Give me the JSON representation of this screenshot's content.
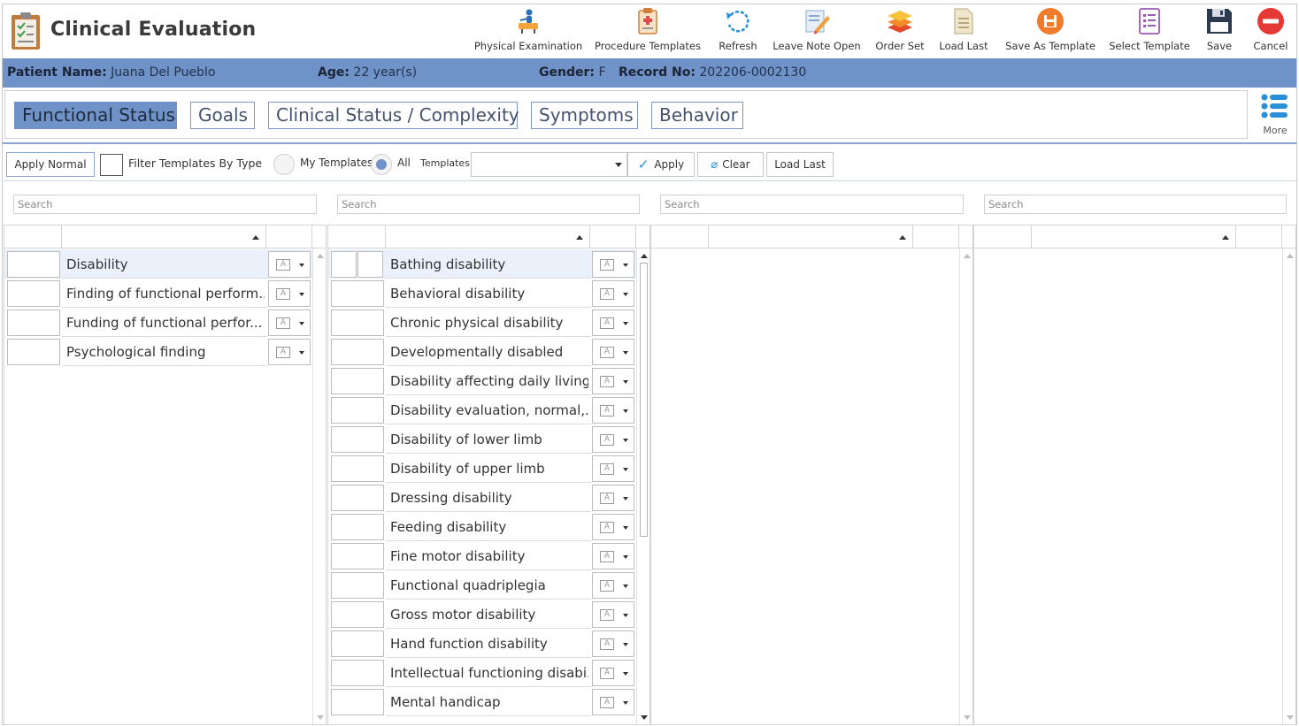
{
  "app": {
    "title": "Clinical Evaluation"
  },
  "toolbar": [
    {
      "label": "Physical Examination",
      "icon": "physical-exam-icon"
    },
    {
      "label": "Procedure Templates",
      "icon": "clipboard-icon"
    },
    {
      "label": "Refresh",
      "icon": "refresh-icon"
    },
    {
      "label": "Leave Note Open",
      "icon": "note-pencil-icon"
    },
    {
      "label": "Order Set",
      "icon": "layers-icon"
    },
    {
      "label": "Load Last",
      "icon": "document-icon"
    },
    {
      "label": "Save As Template",
      "icon": "save-template-icon"
    },
    {
      "label": "Select Template",
      "icon": "template-list-icon"
    },
    {
      "label": "Save",
      "icon": "floppy-icon"
    },
    {
      "label": "Cancel",
      "icon": "cancel-icon"
    }
  ],
  "patient": {
    "name_label": "Patient Name:",
    "name": "Juana Del Pueblo",
    "age_label": "Age:",
    "age": "22 year(s)",
    "gender_label": "Gender:",
    "gender": "F",
    "record_label": "Record No:",
    "record": "202206-0002130"
  },
  "tabs": [
    "Functional Status",
    "Goals",
    "Clinical Status / Complexity",
    "Symptoms",
    "Behavior"
  ],
  "more_label": "More",
  "actions": {
    "apply_normal": "Apply Normal",
    "filter_label": "Filter Templates By Type",
    "my_templates": "My Templates",
    "all": "All",
    "templates_label": "Templates:",
    "apply": "Apply",
    "clear": "Clear",
    "load_last": "Load Last"
  },
  "search_placeholder": "Search",
  "panel1": {
    "items": [
      "Disability",
      "Finding of functional perform...",
      "Funding of functional perfor...",
      "Psychological finding"
    ]
  },
  "panel2": {
    "items": [
      "Bathing disability",
      "Behavioral disability",
      "Chronic physical disability",
      "Developmentally disabled",
      "Disability  affecting daily living",
      "Disability evaluation, normal,...",
      "Disability of lower limb",
      "Disability of upper limb",
      "Dressing disability",
      "Feeding disability",
      "Fine motor disability",
      "Functional quadriplegia",
      "Gross motor disability",
      "Hand function disability",
      "Intellectual functioning disabi...",
      "Mental handicap"
    ]
  },
  "colors": {
    "accent": "#6f93c8",
    "tab_border": "#7c97c4"
  }
}
